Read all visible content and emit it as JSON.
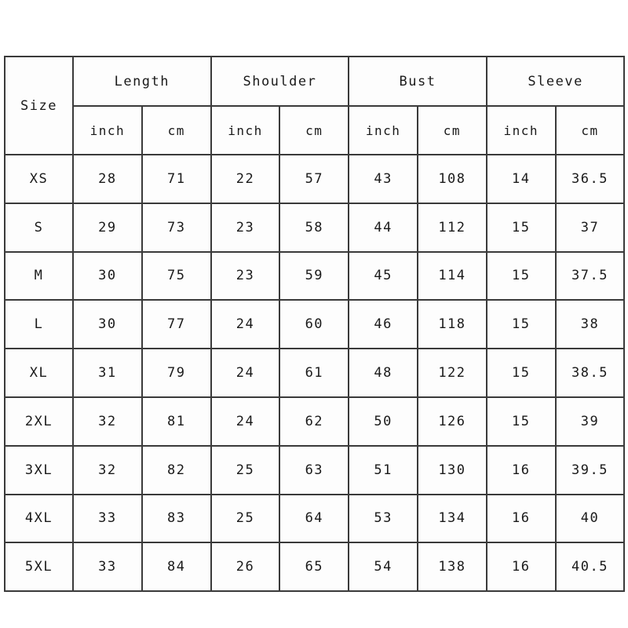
{
  "table": {
    "size_header": "Size",
    "groups": [
      "Length",
      "Shoulder",
      "Bust",
      "Sleeve"
    ],
    "units": [
      "inch",
      "cm",
      "inch",
      "cm",
      "inch",
      "cm",
      "inch",
      "cm"
    ],
    "rows": [
      {
        "size": "XS",
        "values": [
          "28",
          "71",
          "22",
          "57",
          "43",
          "108",
          "14",
          "36.5"
        ]
      },
      {
        "size": "S",
        "values": [
          "29",
          "73",
          "23",
          "58",
          "44",
          "112",
          "15",
          "37"
        ]
      },
      {
        "size": "M",
        "values": [
          "30",
          "75",
          "23",
          "59",
          "45",
          "114",
          "15",
          "37.5"
        ]
      },
      {
        "size": "L",
        "values": [
          "30",
          "77",
          "24",
          "60",
          "46",
          "118",
          "15",
          "38"
        ]
      },
      {
        "size": "XL",
        "values": [
          "31",
          "79",
          "24",
          "61",
          "48",
          "122",
          "15",
          "38.5"
        ]
      },
      {
        "size": "2XL",
        "values": [
          "32",
          "81",
          "24",
          "62",
          "50",
          "126",
          "15",
          "39"
        ]
      },
      {
        "size": "3XL",
        "values": [
          "32",
          "82",
          "25",
          "63",
          "51",
          "130",
          "16",
          "39.5"
        ]
      },
      {
        "size": "4XL",
        "values": [
          "33",
          "83",
          "25",
          "64",
          "53",
          "134",
          "16",
          "40"
        ]
      },
      {
        "size": "5XL",
        "values": [
          "33",
          "84",
          "26",
          "65",
          "54",
          "138",
          "16",
          "40.5"
        ]
      }
    ]
  },
  "style": {
    "border_color": "#3a3a3a",
    "text_color": "#1a1a1a",
    "cell_background": "#fdfdfd",
    "page_background": "#ffffff"
  }
}
